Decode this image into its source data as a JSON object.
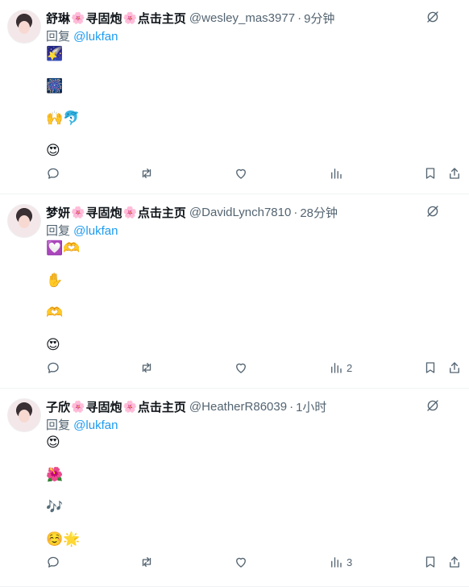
{
  "tweets": [
    {
      "name": "舒琳",
      "blossom": "🌸",
      "suffix1": "寻固炮",
      "suffix2": "点击主页",
      "handle": "@wesley_mas3977",
      "dot": "·",
      "time": "9分钟",
      "reply_prefix": "回复 ",
      "reply_to": "@lukfan",
      "lines": [
        "🌠",
        "🎆",
        "🙌🐬",
        "😍"
      ],
      "views": ""
    },
    {
      "name": "梦妍",
      "blossom": "🌸",
      "suffix1": "寻固炮",
      "suffix2": "点击主页",
      "handle": "@DavidLynch7810",
      "dot": "·",
      "time": "28分钟",
      "reply_prefix": "回复 ",
      "reply_to": "@lukfan",
      "lines": [
        "💟🫶",
        "✋",
        "🫶",
        "😍"
      ],
      "views": "2"
    },
    {
      "name": "子欣",
      "blossom": "🌸",
      "suffix1": "寻固炮",
      "suffix2": "点击主页",
      "handle": "@HeatherR86039",
      "dot": "·",
      "time": "1小时",
      "reply_prefix": "回复 ",
      "reply_to": "@lukfan",
      "lines": [
        "😍",
        "🌺",
        "🎶",
        "☺️🌟"
      ],
      "views": "3"
    }
  ],
  "icons": {
    "grok": "grok-slash-icon",
    "reply": "reply-icon",
    "retweet": "retweet-icon",
    "like": "heart-icon",
    "views": "views-icon",
    "bookmark": "bookmark-icon",
    "share": "share-icon"
  },
  "colors": {
    "mention": "#1d9bf0",
    "secondary": "#536471",
    "divider": "#eff3f4"
  }
}
